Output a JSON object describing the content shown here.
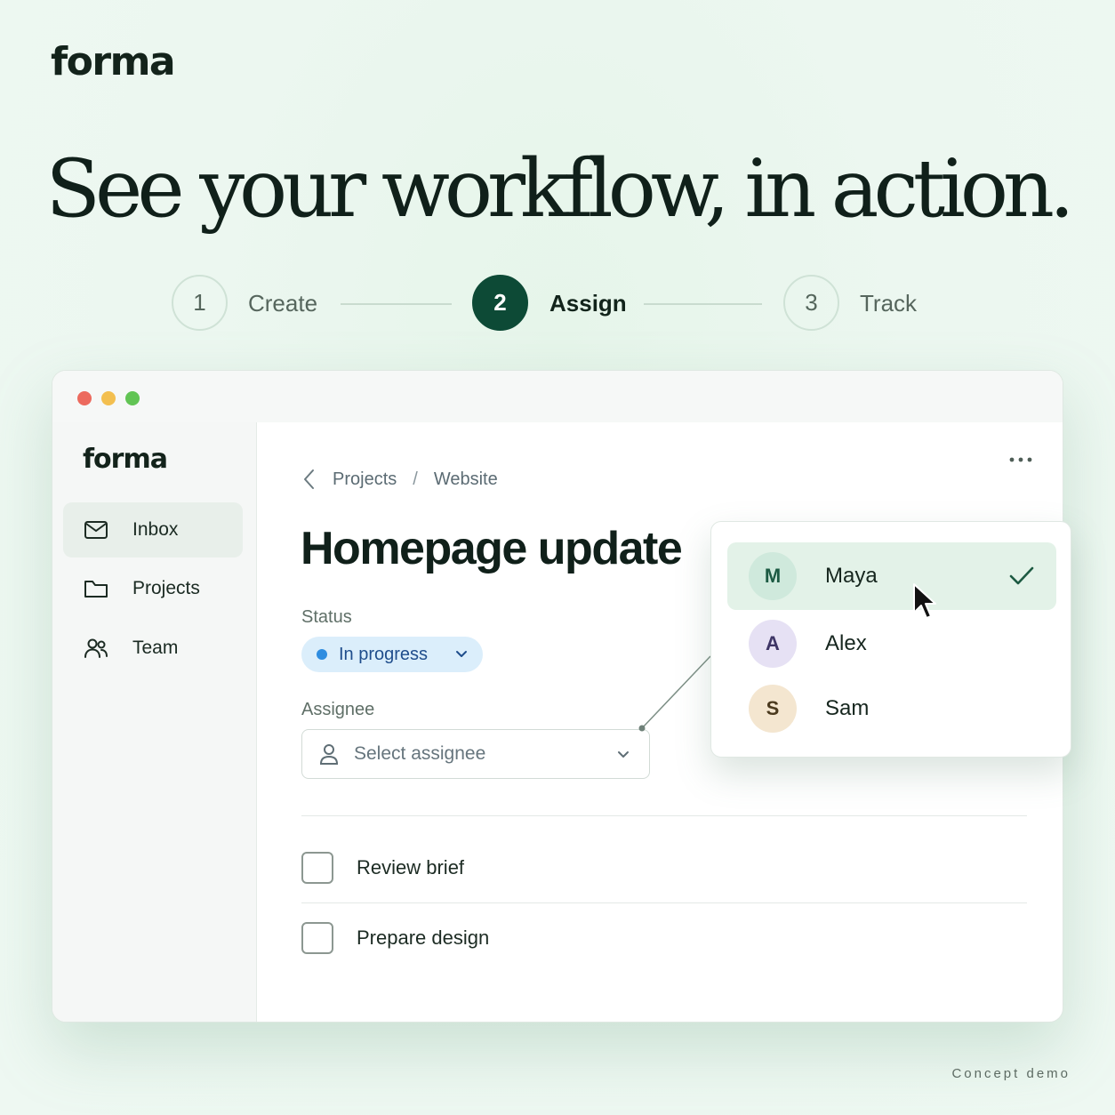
{
  "brand": {
    "logo": "forma"
  },
  "hero": {
    "headline": "See your workflow, in action."
  },
  "stepper": {
    "steps": [
      {
        "number": "1",
        "label": "Create"
      },
      {
        "number": "2",
        "label": "Assign"
      },
      {
        "number": "3",
        "label": "Track"
      }
    ],
    "active_step": 2
  },
  "window": {
    "controls": [
      "close",
      "minimize",
      "zoom"
    ]
  },
  "sidebar": {
    "logo": "forma",
    "items": [
      {
        "label": "Inbox",
        "icon": "mail-icon"
      },
      {
        "label": "Projects",
        "icon": "folder-icon"
      },
      {
        "label": "Team",
        "icon": "users-icon"
      }
    ],
    "active_item": "Inbox"
  },
  "main": {
    "breadcrumb": {
      "parent": "Projects",
      "separator": "/",
      "current": "Website"
    },
    "title": "Homepage update",
    "status": {
      "label": "Status",
      "value": "In progress"
    },
    "assignee": {
      "label": "Assignee",
      "placeholder": "Select assignee"
    },
    "tasks": [
      {
        "label": "Review brief",
        "checked": false
      },
      {
        "label": "Prepare design",
        "checked": false
      }
    ]
  },
  "assignee_dropdown": {
    "options": [
      {
        "initial": "M",
        "name": "Maya",
        "selected": true
      },
      {
        "initial": "A",
        "name": "Alex",
        "selected": false
      },
      {
        "initial": "S",
        "name": "Sam",
        "selected": false
      }
    ]
  },
  "footer": {
    "note": "Concept demo"
  },
  "colors": {
    "accent": "#0d4a36",
    "status_bg": "#dbeefb",
    "status_dot": "#2f8de0",
    "selected_row": "#e3f2e8",
    "avatar_m": "#cfe9dc",
    "avatar_a": "#e6e1f4",
    "avatar_s": "#f4e6d0",
    "dot_red": "#ec6a5e",
    "dot_yellow": "#f3bf4f",
    "dot_green": "#61c454"
  }
}
